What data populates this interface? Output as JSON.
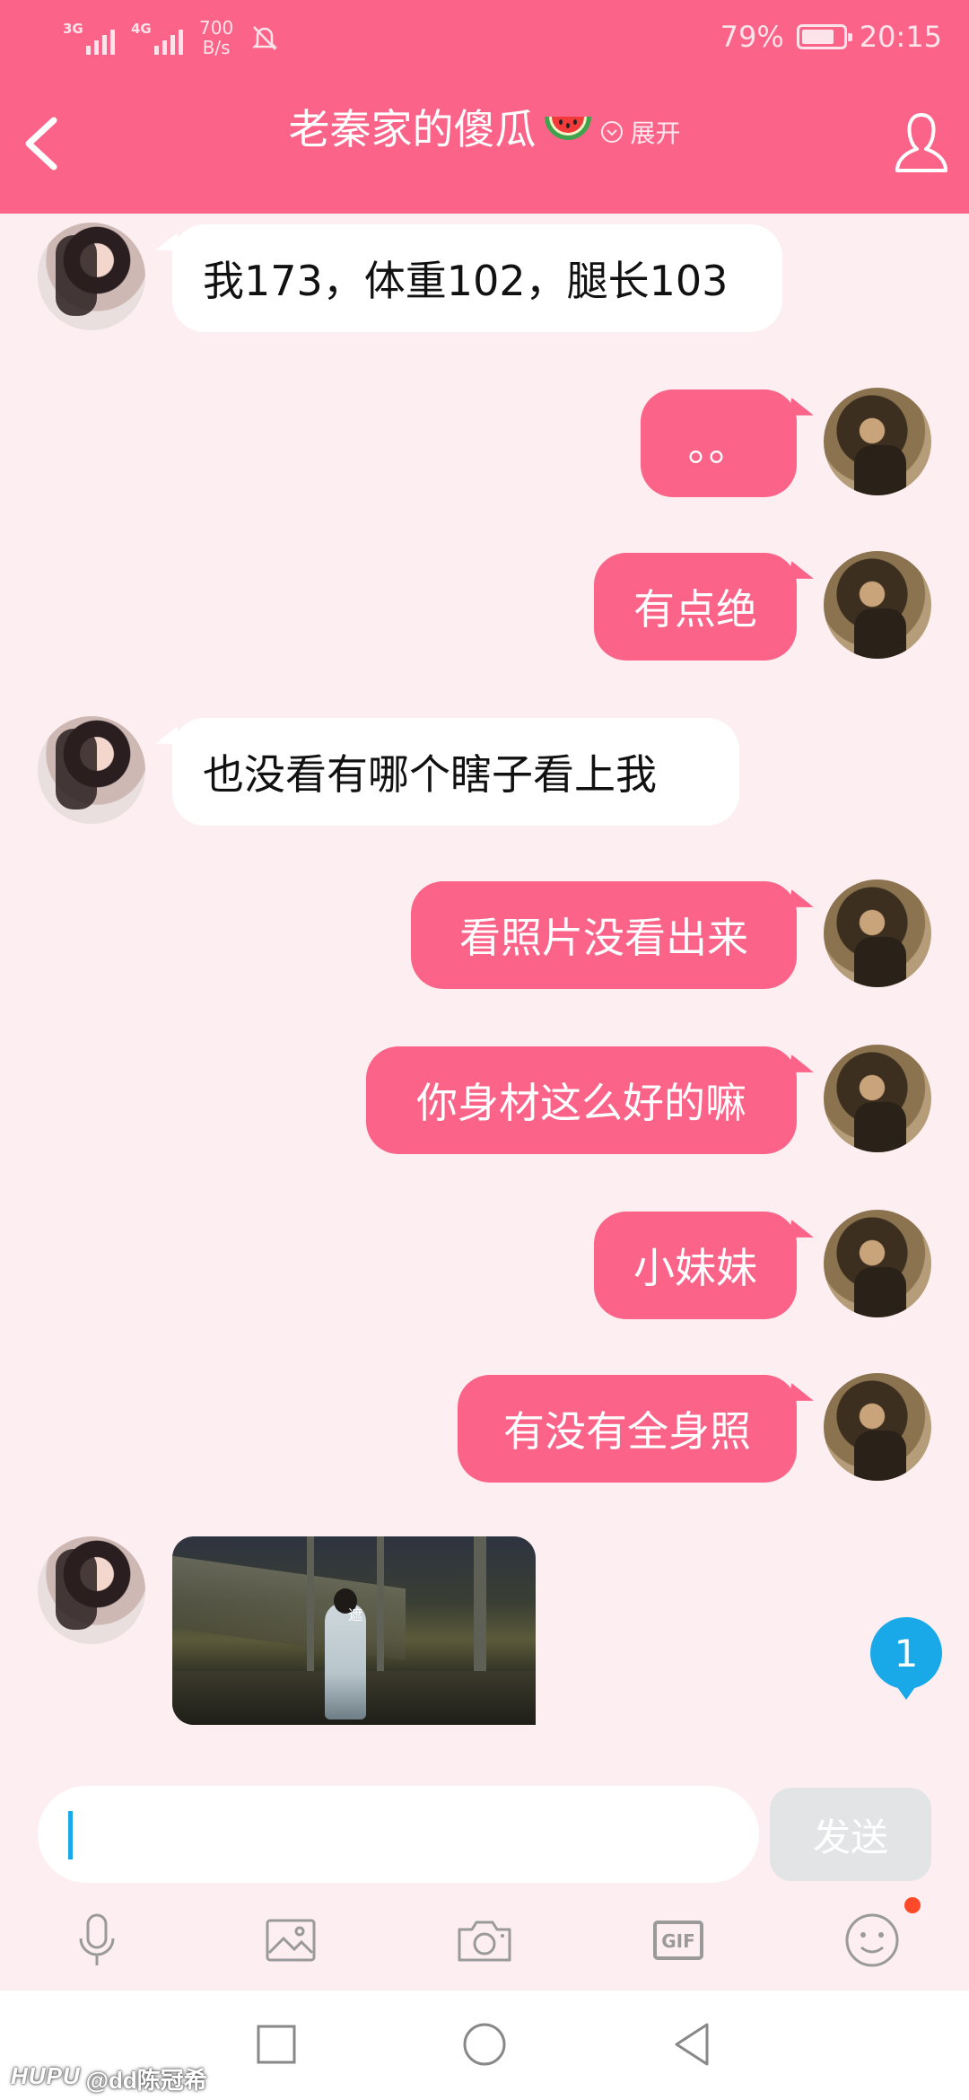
{
  "status_bar": {
    "signal1_label": "3G",
    "signal2_label": "4G",
    "speed_value": "700",
    "speed_unit": "B/s",
    "battery_percent": "79%",
    "battery_level": 0.79,
    "time": "20:15"
  },
  "header": {
    "title": "老秦家的傻瓜",
    "expand_label": "展开",
    "icons": [
      "back-arrow-icon",
      "watermelon-emoji",
      "chevron-down-icon",
      "profile-icon"
    ]
  },
  "messages": [
    {
      "from": "other",
      "text": "我173，体重102，腿长103"
    },
    {
      "from": "me",
      "text": "。。"
    },
    {
      "from": "me",
      "text": "有点绝"
    },
    {
      "from": "other",
      "text": "也没看有哪个瞎子看上我"
    },
    {
      "from": "me",
      "text": "看照片没看出来"
    },
    {
      "from": "me",
      "text": "你身材这么好的嘛"
    },
    {
      "from": "me",
      "text": "小妹妹"
    },
    {
      "from": "me",
      "text": "有没有全身照"
    },
    {
      "from": "other",
      "type": "image",
      "overlay_text": "遮"
    }
  ],
  "unread_badge": "1",
  "input": {
    "value": "",
    "send_label": "发送"
  },
  "toolbar": {
    "items": [
      "microphone-icon",
      "image-icon",
      "camera-icon",
      "gif-icon",
      "emoji-icon"
    ],
    "gif_text": "GIF"
  },
  "colors": {
    "accent": "#fb6488",
    "background": "#fdeef1",
    "badge": "#19a9e8",
    "notification_dot": "#ff4a2a"
  },
  "watermark": {
    "brand": "HUPU",
    "user": "@dd陈冠希"
  }
}
